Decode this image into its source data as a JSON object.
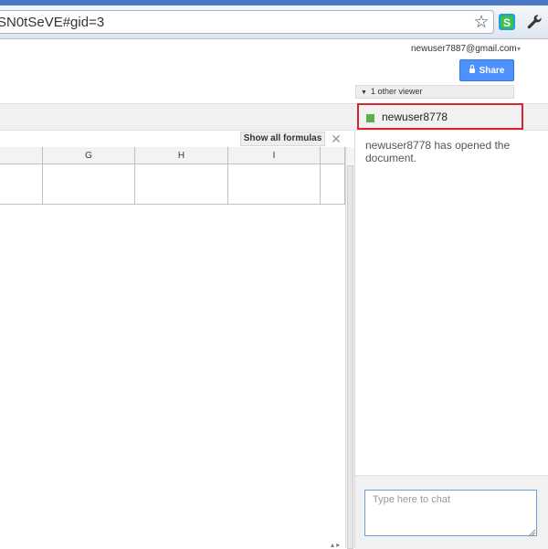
{
  "browser": {
    "url": "SN0tSeVE#gid=3",
    "icons": [
      "star-icon",
      "skype-icon",
      "wrench-icon"
    ]
  },
  "header": {
    "account_email": "newuser7887@gmail.com",
    "account_caret": "▾",
    "share_label": "Share",
    "viewer_toggle_label": "1 other viewer"
  },
  "viewers": [
    {
      "name": "newuser8778",
      "color": "#5bb046"
    }
  ],
  "sheet": {
    "show_formulas_label": "Show all formulas",
    "close_label": "✕",
    "columns": [
      "",
      "G",
      "H",
      "I"
    ]
  },
  "chat": {
    "messages": [
      {
        "text": "newuser8778 has opened the document."
      }
    ],
    "input_placeholder": "Type here to chat",
    "input_value": ""
  },
  "colors": {
    "share_button": "#4d90fe",
    "highlight_border": "#d9232d",
    "viewer_swatch": "#5bb046"
  }
}
